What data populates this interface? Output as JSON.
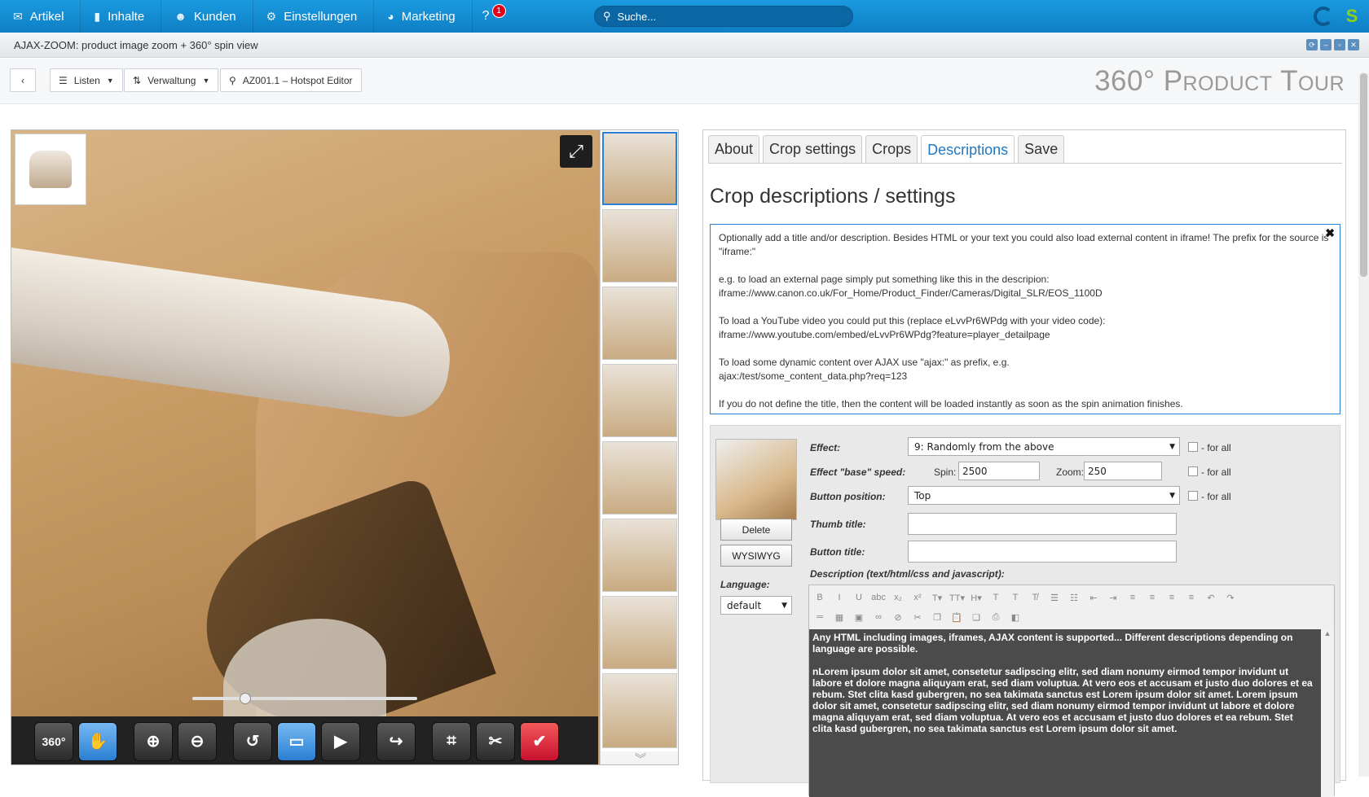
{
  "topnav": {
    "items": [
      {
        "label": "Artikel",
        "icon": "envelope-icon",
        "glyph": "✉"
      },
      {
        "label": "Inhalte",
        "icon": "book-icon",
        "glyph": "▮"
      },
      {
        "label": "Kunden",
        "icon": "users-icon",
        "glyph": "☻"
      },
      {
        "label": "Einstellungen",
        "icon": "gear-icon",
        "glyph": "⚙"
      },
      {
        "label": "Marketing",
        "icon": "pie-chart-icon",
        "glyph": "◕"
      }
    ],
    "help_glyph": "?",
    "notification_count": "1",
    "search_placeholder": "Suche..."
  },
  "window": {
    "title": "AJAX-ZOOM: product image zoom + 360° spin view"
  },
  "toolbar": {
    "back_glyph": "‹",
    "listen": "Listen",
    "verwaltung": "Verwaltung",
    "location": "AZ001.1 – Hotspot Editor"
  },
  "brand": "360° Product Tour",
  "viewer": {
    "controls": [
      "360°",
      "✋",
      "⊕",
      "⊖",
      "↺",
      "▭",
      "▶",
      "↪",
      "⌗",
      "✂",
      "✔"
    ]
  },
  "panel": {
    "tabs": [
      "About",
      "Crop settings",
      "Crops",
      "Descriptions",
      "Save"
    ],
    "active_tab": "Descriptions",
    "title": "Crop descriptions / settings",
    "info": [
      "Optionally add a title and/or description. Besides HTML or your text you could also load external content in iframe! The prefix for the source is \"iframe:\"",
      "e.g. to load an external page simply put something like this in the descripion:",
      "iframe://www.canon.co.uk/For_Home/Product_Finder/Cameras/Digital_SLR/EOS_1100D",
      "To load a YouTube video you could put this (replace eLvvPr6WPdg with your video code):",
      "iframe://www.youtube.com/embed/eLvvPr6WPdg?feature=player_detailpage",
      "To load some dynamic content over AJAX use \"ajax:\" as prefix, e.g.",
      "ajax:/test/some_content_data.php?req=123",
      "If you do not define the title, then the content will be loaded instantly as soon as the spin animation finishes."
    ]
  },
  "form": {
    "delete": "Delete",
    "wysiwyg": "WYSIWYG",
    "effect_label": "Effect:",
    "effect_value": "9: Randomly from the above",
    "speed_label": "Effect \"base\" speed:",
    "spin_label": "Spin:",
    "spin_value": "2500",
    "zoom_label": "Zoom:",
    "zoom_value": "250",
    "for_all": "- for all",
    "button_position_label": "Button position:",
    "button_position_value": "Top",
    "thumb_title_label": "Thumb title:",
    "thumb_title_value": "",
    "button_title_label": "Button title:",
    "button_title_value": "",
    "description_label": "Description (text/html/css and javascript):",
    "language_label": "Language:",
    "language_value": "default",
    "editor_text": [
      "Any HTML including images, iframes, AJAX content is supported... Different descriptions depending on language are possible.",
      "nLorem ipsum dolor sit amet, consetetur sadipscing elitr, sed diam nonumy eirmod tempor invidunt ut labore et dolore magna aliquyam erat, sed diam voluptua. At vero eos et accusam et justo duo dolores et ea rebum. Stet clita kasd gubergren, no sea takimata sanctus est Lorem ipsum dolor sit amet. Lorem ipsum dolor sit amet, consetetur sadipscing elitr, sed diam nonumy eirmod tempor invidunt ut labore et dolore magna aliquyam erat, sed diam voluptua. At vero eos et accusam et justo duo dolores et ea rebum. Stet clita kasd gubergren, no sea takimata sanctus est Lorem ipsum dolor sit amet."
    ]
  }
}
